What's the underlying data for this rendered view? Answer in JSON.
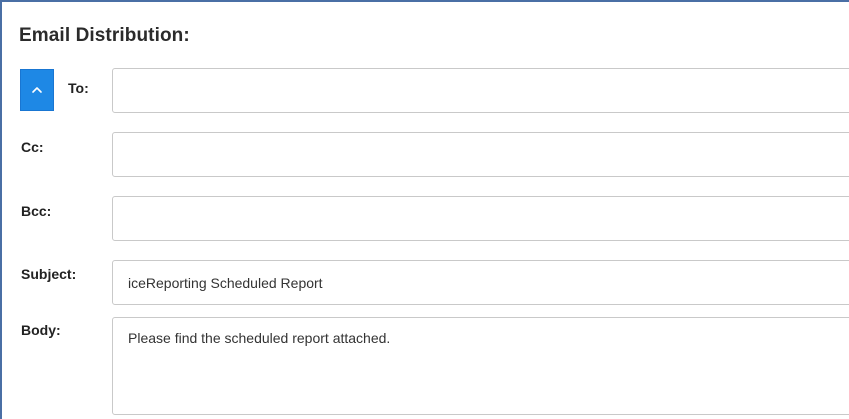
{
  "section": {
    "title": "Email Distribution:",
    "collapse_icon": "chevron-up-icon",
    "accent_color": "#1e88e5"
  },
  "fields": {
    "to": {
      "label": "To:",
      "value": ""
    },
    "cc": {
      "label": "Cc:",
      "value": ""
    },
    "bcc": {
      "label": "Bcc:",
      "value": ""
    },
    "subject": {
      "label": "Subject:",
      "value": "iceReporting Scheduled Report"
    },
    "body": {
      "label": "Body:",
      "value": "Please find the scheduled report attached."
    }
  }
}
